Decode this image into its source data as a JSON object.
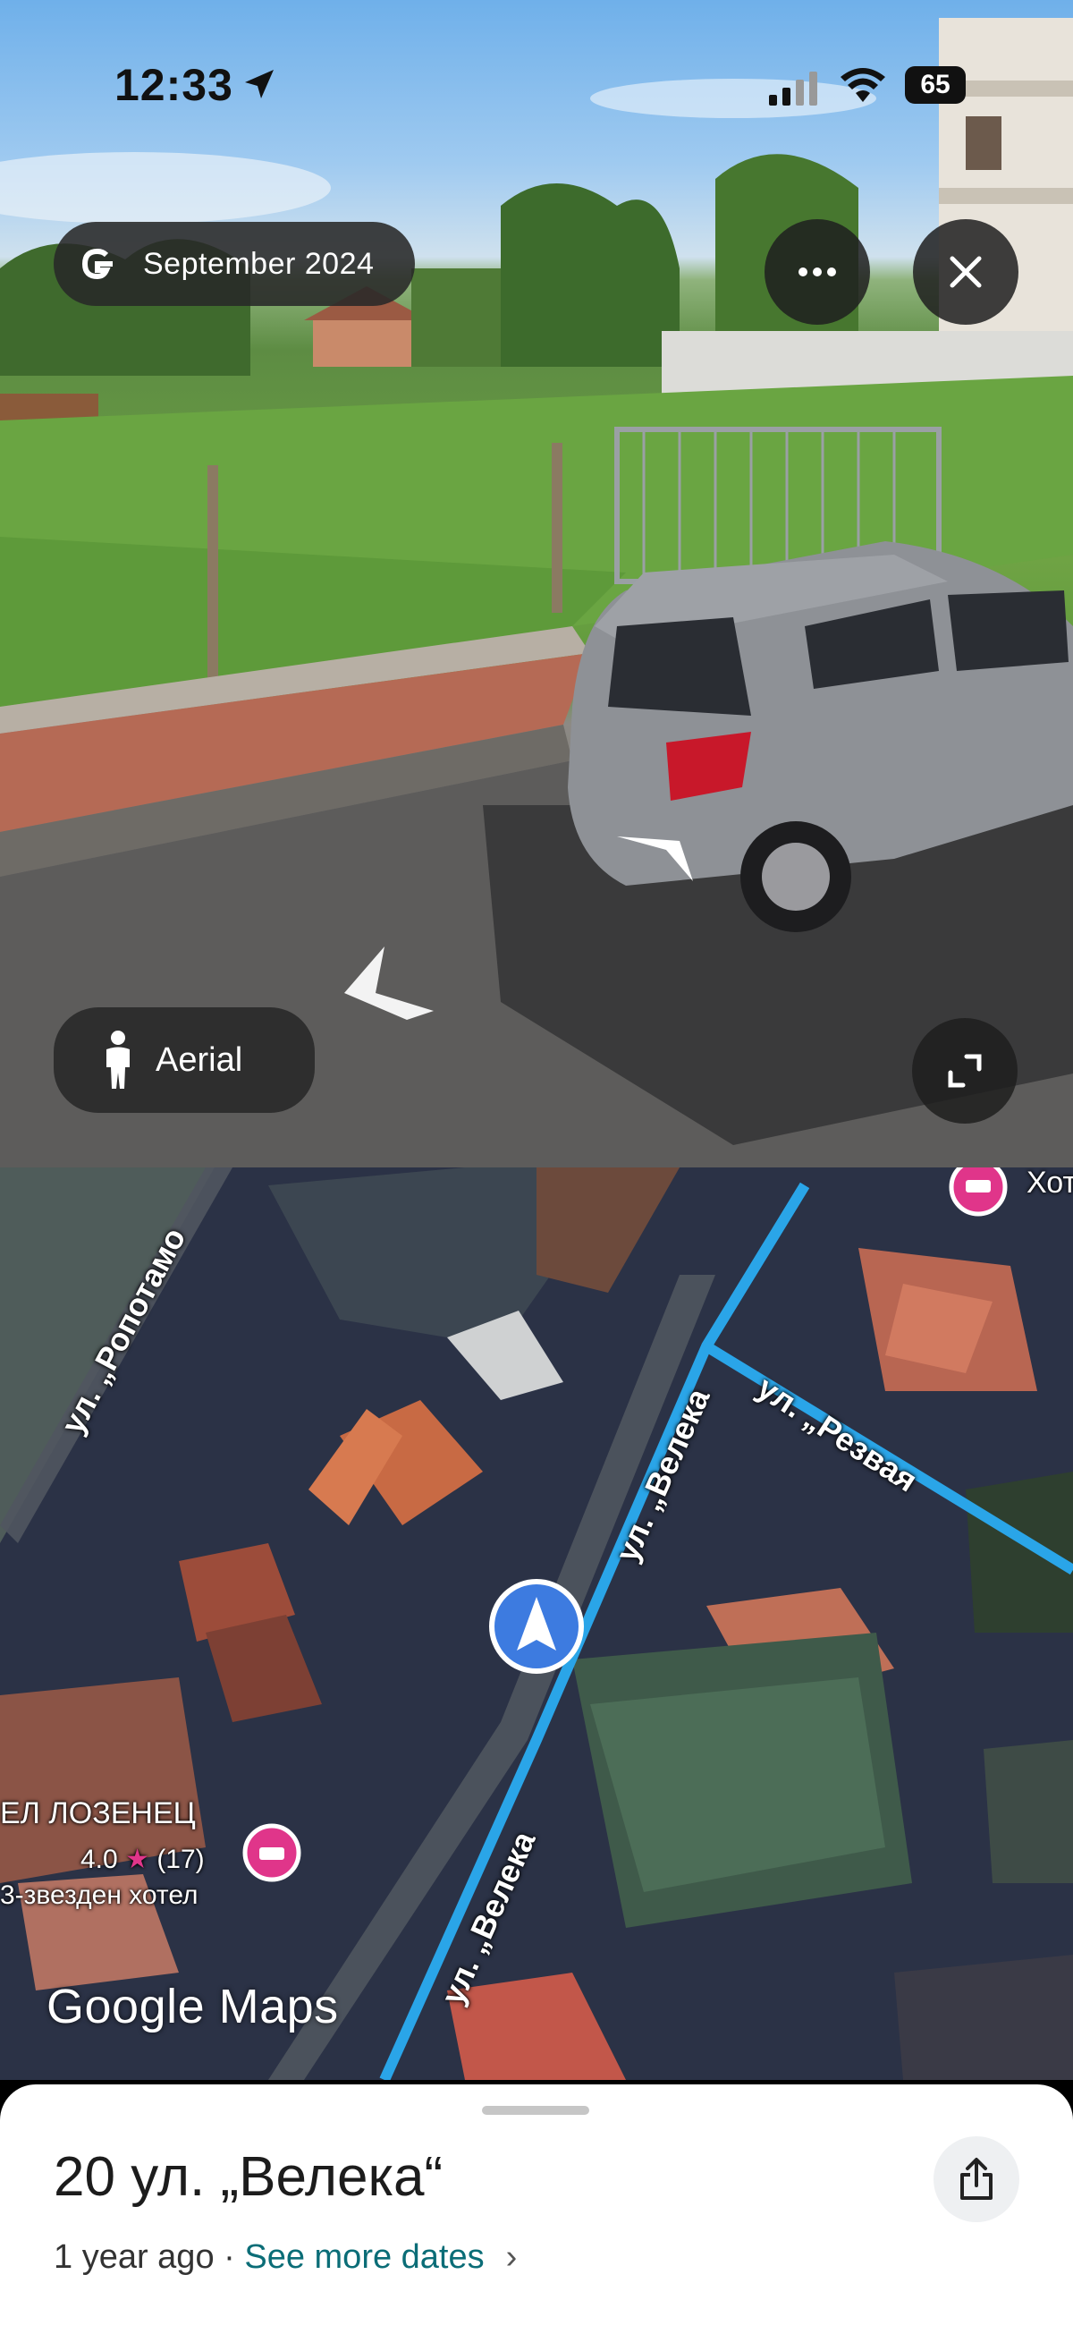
{
  "status_bar": {
    "time": "12:33",
    "battery": "65"
  },
  "street_view": {
    "date_label": "September 2024",
    "more_icon": "more-horiz-icon",
    "close_icon": "close-icon",
    "aerial_label": "Aerial",
    "expand_icon": "fullscreen-icon"
  },
  "map": {
    "streets": [
      "ул. „Ропотамо",
      "ул. „Велека",
      "ул. „Резвая",
      "ул. „Велека"
    ],
    "hotel_top_label": "Хот",
    "hotel_left": {
      "name": "ЕЛ ЛОЗЕНЕЦ",
      "rating": "4.0",
      "rating_count": "(17)",
      "category": "3-звезден хотел"
    },
    "logo": "Google Maps"
  },
  "sheet": {
    "address": "20 ул. „Велека“",
    "age": "1 year ago",
    "separator": " · ",
    "more_dates": "See more dates",
    "chevron": "›"
  },
  "colors": {
    "route": "#2aa5e8",
    "location_dot": "#3d7be0",
    "hotel_pin": "#e0358a",
    "link": "#0b6d77"
  }
}
